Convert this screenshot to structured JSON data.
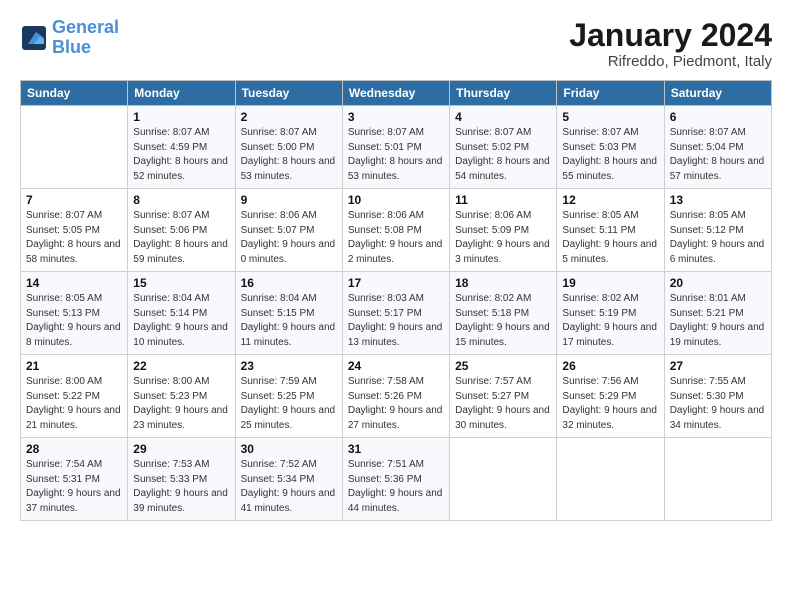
{
  "header": {
    "logo_line1": "General",
    "logo_line2": "Blue",
    "main_title": "January 2024",
    "sub_title": "Rifreddo, Piedmont, Italy"
  },
  "days_of_week": [
    "Sunday",
    "Monday",
    "Tuesday",
    "Wednesday",
    "Thursday",
    "Friday",
    "Saturday"
  ],
  "weeks": [
    [
      {
        "day": "",
        "sunrise": "",
        "sunset": "",
        "daylight": ""
      },
      {
        "day": "1",
        "sunrise": "Sunrise: 8:07 AM",
        "sunset": "Sunset: 4:59 PM",
        "daylight": "Daylight: 8 hours and 52 minutes."
      },
      {
        "day": "2",
        "sunrise": "Sunrise: 8:07 AM",
        "sunset": "Sunset: 5:00 PM",
        "daylight": "Daylight: 8 hours and 53 minutes."
      },
      {
        "day": "3",
        "sunrise": "Sunrise: 8:07 AM",
        "sunset": "Sunset: 5:01 PM",
        "daylight": "Daylight: 8 hours and 53 minutes."
      },
      {
        "day": "4",
        "sunrise": "Sunrise: 8:07 AM",
        "sunset": "Sunset: 5:02 PM",
        "daylight": "Daylight: 8 hours and 54 minutes."
      },
      {
        "day": "5",
        "sunrise": "Sunrise: 8:07 AM",
        "sunset": "Sunset: 5:03 PM",
        "daylight": "Daylight: 8 hours and 55 minutes."
      },
      {
        "day": "6",
        "sunrise": "Sunrise: 8:07 AM",
        "sunset": "Sunset: 5:04 PM",
        "daylight": "Daylight: 8 hours and 57 minutes."
      }
    ],
    [
      {
        "day": "7",
        "sunrise": "Sunrise: 8:07 AM",
        "sunset": "Sunset: 5:05 PM",
        "daylight": "Daylight: 8 hours and 58 minutes."
      },
      {
        "day": "8",
        "sunrise": "Sunrise: 8:07 AM",
        "sunset": "Sunset: 5:06 PM",
        "daylight": "Daylight: 8 hours and 59 minutes."
      },
      {
        "day": "9",
        "sunrise": "Sunrise: 8:06 AM",
        "sunset": "Sunset: 5:07 PM",
        "daylight": "Daylight: 9 hours and 0 minutes."
      },
      {
        "day": "10",
        "sunrise": "Sunrise: 8:06 AM",
        "sunset": "Sunset: 5:08 PM",
        "daylight": "Daylight: 9 hours and 2 minutes."
      },
      {
        "day": "11",
        "sunrise": "Sunrise: 8:06 AM",
        "sunset": "Sunset: 5:09 PM",
        "daylight": "Daylight: 9 hours and 3 minutes."
      },
      {
        "day": "12",
        "sunrise": "Sunrise: 8:05 AM",
        "sunset": "Sunset: 5:11 PM",
        "daylight": "Daylight: 9 hours and 5 minutes."
      },
      {
        "day": "13",
        "sunrise": "Sunrise: 8:05 AM",
        "sunset": "Sunset: 5:12 PM",
        "daylight": "Daylight: 9 hours and 6 minutes."
      }
    ],
    [
      {
        "day": "14",
        "sunrise": "Sunrise: 8:05 AM",
        "sunset": "Sunset: 5:13 PM",
        "daylight": "Daylight: 9 hours and 8 minutes."
      },
      {
        "day": "15",
        "sunrise": "Sunrise: 8:04 AM",
        "sunset": "Sunset: 5:14 PM",
        "daylight": "Daylight: 9 hours and 10 minutes."
      },
      {
        "day": "16",
        "sunrise": "Sunrise: 8:04 AM",
        "sunset": "Sunset: 5:15 PM",
        "daylight": "Daylight: 9 hours and 11 minutes."
      },
      {
        "day": "17",
        "sunrise": "Sunrise: 8:03 AM",
        "sunset": "Sunset: 5:17 PM",
        "daylight": "Daylight: 9 hours and 13 minutes."
      },
      {
        "day": "18",
        "sunrise": "Sunrise: 8:02 AM",
        "sunset": "Sunset: 5:18 PM",
        "daylight": "Daylight: 9 hours and 15 minutes."
      },
      {
        "day": "19",
        "sunrise": "Sunrise: 8:02 AM",
        "sunset": "Sunset: 5:19 PM",
        "daylight": "Daylight: 9 hours and 17 minutes."
      },
      {
        "day": "20",
        "sunrise": "Sunrise: 8:01 AM",
        "sunset": "Sunset: 5:21 PM",
        "daylight": "Daylight: 9 hours and 19 minutes."
      }
    ],
    [
      {
        "day": "21",
        "sunrise": "Sunrise: 8:00 AM",
        "sunset": "Sunset: 5:22 PM",
        "daylight": "Daylight: 9 hours and 21 minutes."
      },
      {
        "day": "22",
        "sunrise": "Sunrise: 8:00 AM",
        "sunset": "Sunset: 5:23 PM",
        "daylight": "Daylight: 9 hours and 23 minutes."
      },
      {
        "day": "23",
        "sunrise": "Sunrise: 7:59 AM",
        "sunset": "Sunset: 5:25 PM",
        "daylight": "Daylight: 9 hours and 25 minutes."
      },
      {
        "day": "24",
        "sunrise": "Sunrise: 7:58 AM",
        "sunset": "Sunset: 5:26 PM",
        "daylight": "Daylight: 9 hours and 27 minutes."
      },
      {
        "day": "25",
        "sunrise": "Sunrise: 7:57 AM",
        "sunset": "Sunset: 5:27 PM",
        "daylight": "Daylight: 9 hours and 30 minutes."
      },
      {
        "day": "26",
        "sunrise": "Sunrise: 7:56 AM",
        "sunset": "Sunset: 5:29 PM",
        "daylight": "Daylight: 9 hours and 32 minutes."
      },
      {
        "day": "27",
        "sunrise": "Sunrise: 7:55 AM",
        "sunset": "Sunset: 5:30 PM",
        "daylight": "Daylight: 9 hours and 34 minutes."
      }
    ],
    [
      {
        "day": "28",
        "sunrise": "Sunrise: 7:54 AM",
        "sunset": "Sunset: 5:31 PM",
        "daylight": "Daylight: 9 hours and 37 minutes."
      },
      {
        "day": "29",
        "sunrise": "Sunrise: 7:53 AM",
        "sunset": "Sunset: 5:33 PM",
        "daylight": "Daylight: 9 hours and 39 minutes."
      },
      {
        "day": "30",
        "sunrise": "Sunrise: 7:52 AM",
        "sunset": "Sunset: 5:34 PM",
        "daylight": "Daylight: 9 hours and 41 minutes."
      },
      {
        "day": "31",
        "sunrise": "Sunrise: 7:51 AM",
        "sunset": "Sunset: 5:36 PM",
        "daylight": "Daylight: 9 hours and 44 minutes."
      },
      {
        "day": "",
        "sunrise": "",
        "sunset": "",
        "daylight": ""
      },
      {
        "day": "",
        "sunrise": "",
        "sunset": "",
        "daylight": ""
      },
      {
        "day": "",
        "sunrise": "",
        "sunset": "",
        "daylight": ""
      }
    ]
  ]
}
